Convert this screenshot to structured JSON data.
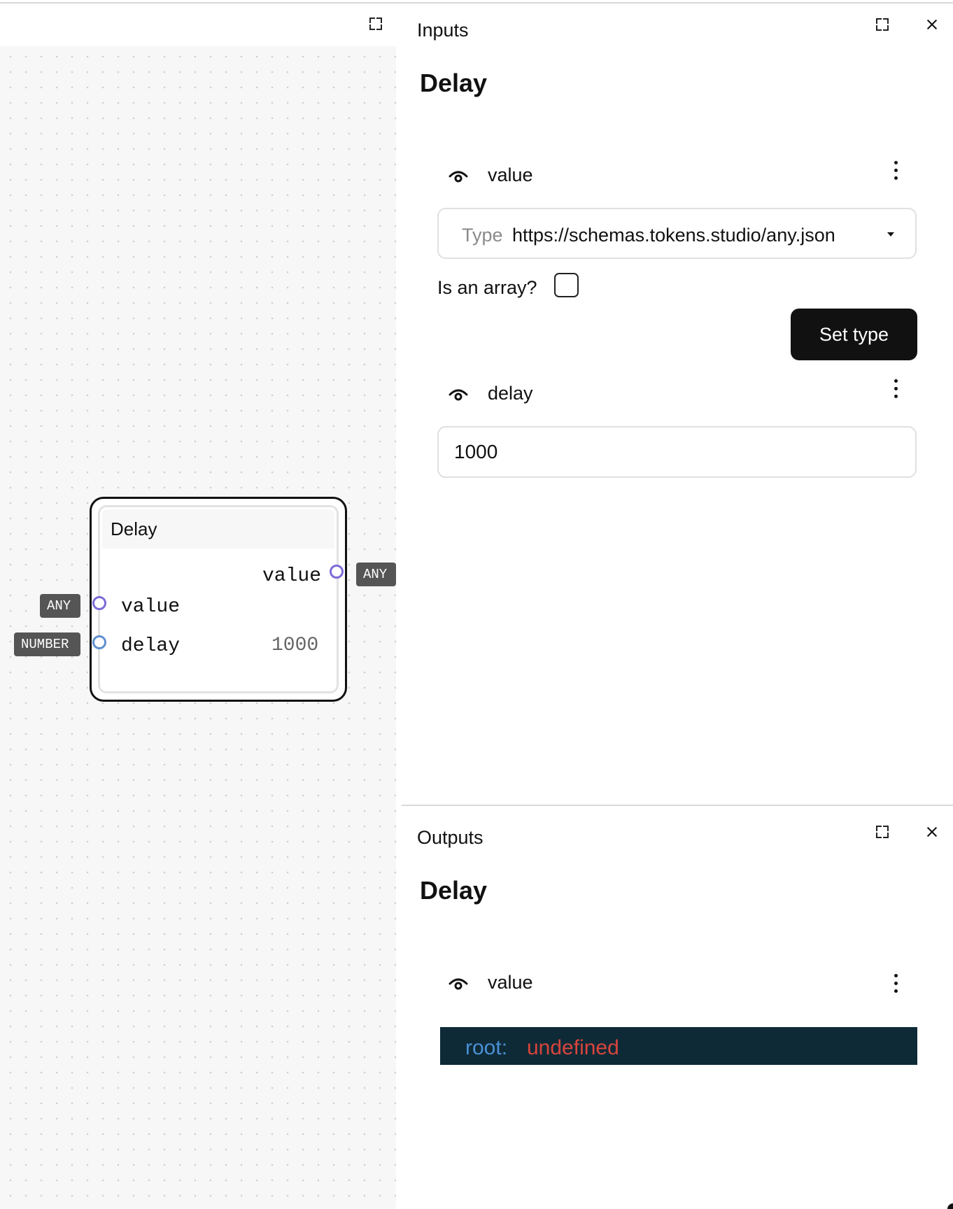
{
  "inputs_panel": {
    "title": "Inputs",
    "node_name": "Delay",
    "value_input": {
      "label": "value",
      "type_label": "Type",
      "type_value": "https://schemas.tokens.studio/any.json",
      "array_label": "Is an array?",
      "array_checked": false,
      "set_type_label": "Set type"
    },
    "delay_input": {
      "label": "delay",
      "value": "1000"
    }
  },
  "outputs_panel": {
    "title": "Outputs",
    "node_name": "Delay",
    "value_output": {
      "label": "value",
      "key": "root:",
      "value": "undefined"
    }
  },
  "canvas": {
    "node": {
      "title": "Delay",
      "output_value_label": "value",
      "output_value_type": "ANY",
      "input_value_label": "value",
      "input_value_type": "ANY",
      "input_delay_label": "delay",
      "input_delay_type": "NUMBER",
      "input_delay_value": "1000"
    }
  },
  "icons": {
    "maximize": "expand-icon",
    "close": "close-icon",
    "visibility": "eye-icon",
    "more": "kebab-menu-icon",
    "dropdown": "chevron-down-icon"
  },
  "colors": {
    "port_any": "#7b6bd8",
    "port_number": "#5f8fd0",
    "code_bg": "#0e2a36",
    "code_key": "#4a90d6",
    "code_value": "#d9453c"
  }
}
